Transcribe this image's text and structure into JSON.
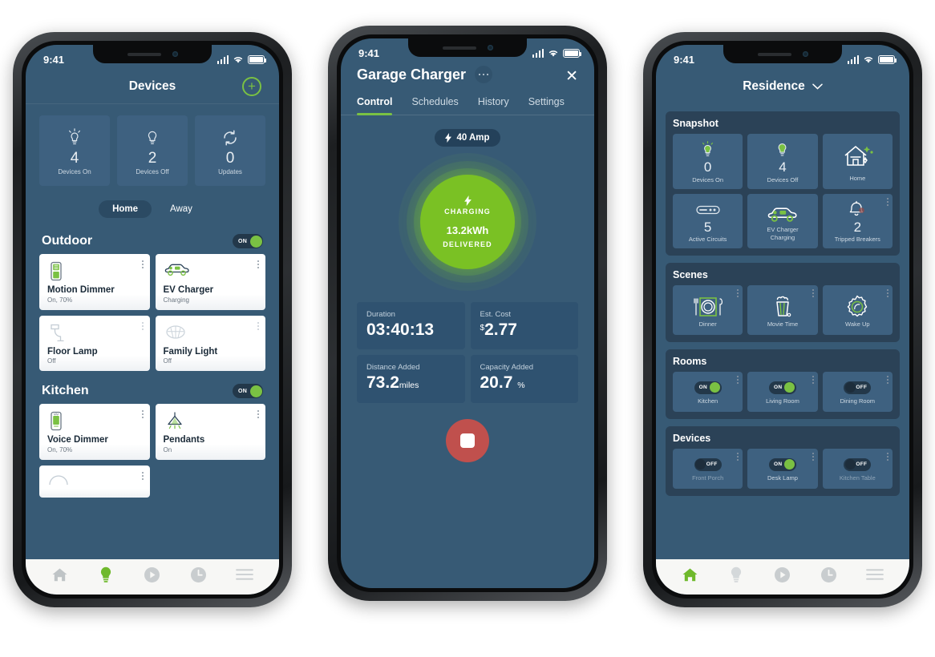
{
  "status_bar": {
    "time": "9:41",
    "signal_icon": "cellular-bars-icon",
    "wifi_icon": "wifi-icon",
    "battery_icon": "battery-full-icon"
  },
  "phone1": {
    "header": {
      "title": "Devices",
      "add_label": "+",
      "add_icon": "plus-circle-icon"
    },
    "stats": [
      {
        "icon": "bulb-on-icon",
        "value": "4",
        "label": "Devices On"
      },
      {
        "icon": "bulb-off-icon",
        "value": "2",
        "label": "Devices Off"
      },
      {
        "icon": "refresh-icon",
        "value": "0",
        "label": "Updates"
      }
    ],
    "segments": [
      {
        "label": "Home",
        "selected": true
      },
      {
        "label": "Away",
        "selected": false
      }
    ],
    "groups": [
      {
        "title": "Outdoor",
        "toggle": {
          "state": "ON",
          "on": true
        },
        "devices": [
          {
            "icon": "dimmer-switch-icon",
            "name": "Motion Dimmer",
            "status": "On, 70%"
          },
          {
            "icon": "ev-car-icon",
            "name": "EV Charger",
            "status": "Charging"
          },
          {
            "icon": "floor-lamp-icon",
            "name": "Floor Lamp",
            "status": "Off"
          },
          {
            "icon": "ceiling-light-icon",
            "name": "Family Light",
            "status": "Off"
          }
        ]
      },
      {
        "title": "Kitchen",
        "toggle": {
          "state": "ON",
          "on": true
        },
        "devices": [
          {
            "icon": "voice-dimmer-icon",
            "name": "Voice Dimmer",
            "status": "On, 70%"
          },
          {
            "icon": "pendant-light-icon",
            "name": "Pendants",
            "status": "On"
          }
        ]
      }
    ],
    "nav": [
      {
        "icon": "home-icon",
        "active": false
      },
      {
        "icon": "bulb-icon",
        "active": true
      },
      {
        "icon": "play-icon",
        "active": false
      },
      {
        "icon": "clock-icon",
        "active": false
      },
      {
        "icon": "menu-icon",
        "active": false
      }
    ]
  },
  "phone2": {
    "header": {
      "title": "Garage Charger",
      "more_icon": "more-horizontal-icon",
      "close_icon": "close-icon",
      "close_label": "✕"
    },
    "tabs": [
      {
        "label": "Control",
        "active": true
      },
      {
        "label": "Schedules",
        "active": false
      },
      {
        "label": "History",
        "active": false
      },
      {
        "label": "Settings",
        "active": false
      }
    ],
    "amp_pill": {
      "icon": "lightning-bolt-icon",
      "label": "40 Amp"
    },
    "dial": {
      "bolt_icon": "lightning-bolt-icon",
      "state_label": "CHARGING",
      "value": "13.2",
      "unit": "kWh",
      "sub_label": "DELIVERED",
      "color": "#7ac124"
    },
    "metrics": [
      {
        "key": "Duration",
        "value": "03:40:13",
        "unit": "",
        "prefix": ""
      },
      {
        "key": "Est. Cost",
        "value": "2.77",
        "unit": "",
        "prefix": "$"
      },
      {
        "key": "Distance Added",
        "value": "73.2",
        "unit": "miles",
        "prefix": ""
      },
      {
        "key": "Capacity Added",
        "value": "20.7",
        "unit": "%",
        "prefix": ""
      }
    ],
    "stop_button": {
      "icon": "stop-square-icon",
      "color": "#c0504d"
    }
  },
  "phone3": {
    "header": {
      "title": "Residence",
      "chevron_icon": "chevron-down-icon"
    },
    "snapshot": {
      "title": "Snapshot",
      "tiles": [
        {
          "icon": "bulb-on-icon",
          "value": "0",
          "label": "Devices On",
          "sub": ""
        },
        {
          "icon": "bulb-off-icon",
          "value": "4",
          "label": "Devices Off",
          "sub": ""
        },
        {
          "icon": "home-sparkle-icon",
          "value": "",
          "label": "Home",
          "sub": ""
        },
        {
          "icon": "circuit-icon",
          "value": "5",
          "label": "Active Circuits",
          "sub": ""
        },
        {
          "icon": "ev-car-icon",
          "value": "",
          "label": "EV Charger",
          "sub": "Charging"
        },
        {
          "icon": "bell-alert-icon",
          "value": "2",
          "label": "Tripped Breakers",
          "sub": ""
        }
      ]
    },
    "scenes": {
      "title": "Scenes",
      "tiles": [
        {
          "icon": "dinner-plate-icon",
          "label": "Dinner"
        },
        {
          "icon": "popcorn-icon",
          "label": "Movie Time"
        },
        {
          "icon": "sun-icon",
          "label": "Wake Up"
        }
      ]
    },
    "rooms": {
      "title": "Rooms",
      "tiles": [
        {
          "label": "Kitchen",
          "state": "ON",
          "on": true,
          "dim": false
        },
        {
          "label": "Living Room",
          "state": "ON",
          "on": true,
          "dim": false
        },
        {
          "label": "Dining Room",
          "state": "OFF",
          "on": false,
          "dim": false
        }
      ]
    },
    "devices": {
      "title": "Devices",
      "tiles": [
        {
          "label": "Front Porch",
          "state": "OFF",
          "on": false,
          "dim": true
        },
        {
          "label": "Desk Lamp",
          "state": "ON",
          "on": true,
          "dim": false
        },
        {
          "label": "Kitchen Table",
          "state": "OFF",
          "on": false,
          "dim": true
        }
      ]
    },
    "nav": [
      {
        "icon": "home-icon",
        "active": true
      },
      {
        "icon": "bulb-icon",
        "active": false
      },
      {
        "icon": "play-icon",
        "active": false
      },
      {
        "icon": "clock-icon",
        "active": false
      },
      {
        "icon": "menu-icon",
        "active": false
      }
    ]
  },
  "colors": {
    "screen_bg": "#375a75",
    "card_bg": "#3e6180",
    "accent_green": "#7ac143",
    "stop_red": "#c0504d",
    "nav_bg": "#f7f7f5"
  }
}
